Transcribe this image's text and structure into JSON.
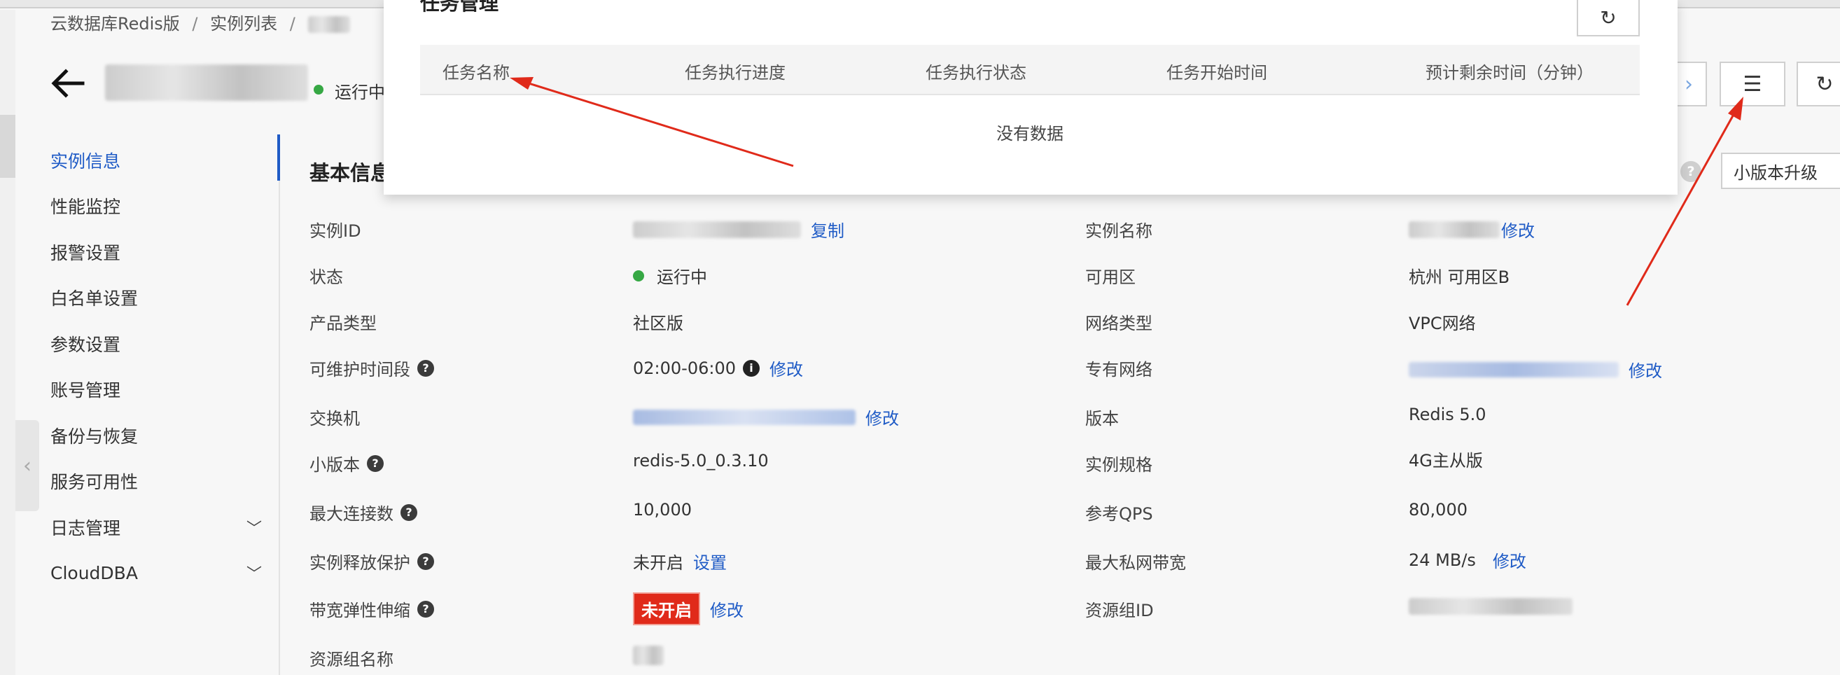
{
  "breadcrumb": {
    "items": [
      "云数据库Redis版",
      "实例列表"
    ],
    "separator": "/"
  },
  "header": {
    "status": "运行中"
  },
  "sidebar": {
    "items": [
      {
        "label": "实例信息"
      },
      {
        "label": "性能监控"
      },
      {
        "label": "报警设置"
      },
      {
        "label": "白名单设置"
      },
      {
        "label": "参数设置"
      },
      {
        "label": "账号管理"
      },
      {
        "label": "备份与恢复"
      },
      {
        "label": "服务可用性"
      },
      {
        "label": "日志管理"
      },
      {
        "label": "CloudDBA"
      }
    ]
  },
  "task_panel": {
    "title": "任务管理",
    "columns": [
      "任务名称",
      "任务执行进度",
      "任务执行状态",
      "任务开始时间",
      "预计剩余时间（分钟）"
    ],
    "empty_text": "没有数据"
  },
  "basic_info": {
    "title": "基本信息",
    "minor_upgrade_label": "小版本升级",
    "left": [
      {
        "label": "实例ID",
        "link": "复制"
      },
      {
        "label": "状态",
        "value": "运行中"
      },
      {
        "label": "产品类型",
        "value": "社区版"
      },
      {
        "label": "可维护时间段",
        "value": "02:00-06:00",
        "link": "修改"
      },
      {
        "label": "交换机",
        "link": "修改"
      },
      {
        "label": "小版本",
        "value": "redis-5.0_0.3.10"
      },
      {
        "label": "最大连接数",
        "value": "10,000"
      },
      {
        "label": "实例释放保护",
        "value": "未开启",
        "link": "设置"
      },
      {
        "label": "带宽弹性伸缩",
        "value": "未开启",
        "link": "修改"
      },
      {
        "label": "资源组名称"
      }
    ],
    "right": [
      {
        "label": "实例名称",
        "link": "修改"
      },
      {
        "label": "可用区",
        "value": "杭州 可用区B"
      },
      {
        "label": "网络类型",
        "value": "VPC网络"
      },
      {
        "label": "专有网络",
        "link": "修改"
      },
      {
        "label": "版本",
        "value": "Redis 5.0"
      },
      {
        "label": "实例规格",
        "value": "4G主从版"
      },
      {
        "label": "参考QPS",
        "value": "80,000"
      },
      {
        "label": "最大私网带宽",
        "value": "24 MB/s",
        "link": "修改"
      },
      {
        "label": "资源组ID"
      }
    ]
  },
  "colors": {
    "accent": "#1f5bc6",
    "running": "#36a844",
    "badge_red": "#e02a1a",
    "annotation_arrow": "#e02a1a"
  }
}
